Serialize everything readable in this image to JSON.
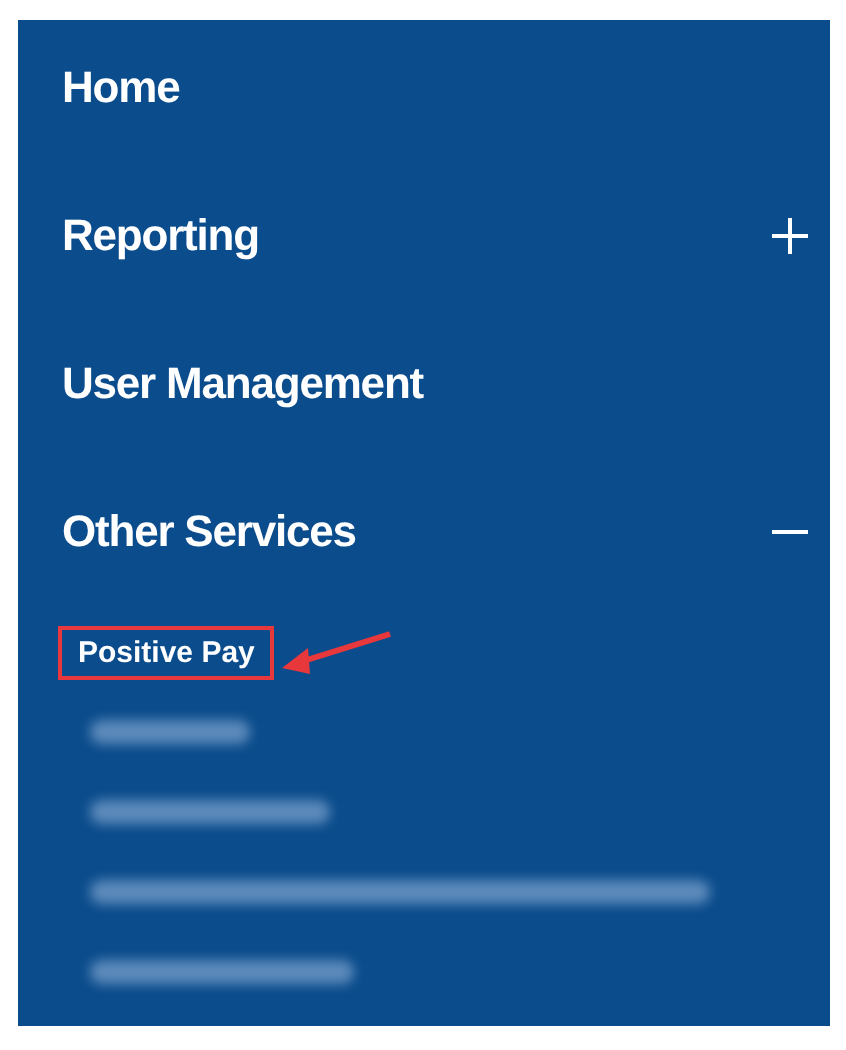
{
  "menu": [
    {
      "label": "Home",
      "kind": "link"
    },
    {
      "label": "Reporting",
      "kind": "group",
      "expanded": false
    },
    {
      "label": "User Management",
      "kind": "link"
    },
    {
      "label": "Other Services",
      "kind": "group",
      "expanded": true,
      "children": [
        {
          "kind": "item",
          "label": "Positive Pay",
          "highlighted": true
        },
        {
          "kind": "redacted"
        },
        {
          "kind": "redacted"
        },
        {
          "kind": "redacted"
        },
        {
          "kind": "redacted"
        }
      ]
    }
  ]
}
